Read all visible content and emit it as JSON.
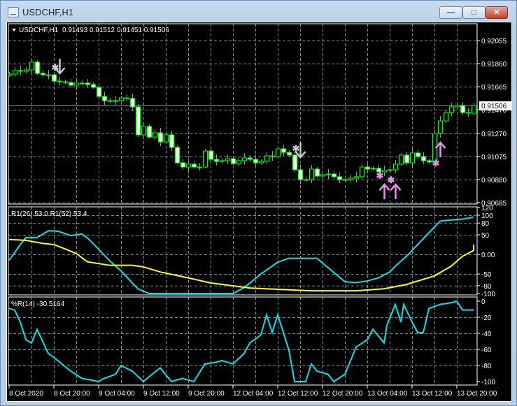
{
  "window": {
    "title": "USDCHF,H1",
    "buttons": {
      "minimize": "—",
      "maximize": "□",
      "close": "✕"
    }
  },
  "header": {
    "symbol": "USDCHF,H1",
    "ohlc": "0.91493 0.91512 0.91451 0.91506"
  },
  "colors": {
    "background": "#000000",
    "candle": "#00ff00",
    "bear_fill": "#ffffff",
    "grid": "#7f8a96",
    "line1": "#00e5ee",
    "line2": "#ffff00",
    "down_arrow": "#c8c8d2",
    "up_arrow": "#e88ef0"
  },
  "price_axis": {
    "labels": [
      "0.92055",
      "0.91860",
      "0.91665",
      "0.91470",
      "0.91270",
      "0.91075",
      "0.90880",
      "0.90685"
    ],
    "current_price": "0.91506"
  },
  "time_axis": {
    "labels": [
      "8 Oct 2020",
      "8 Oct 20:00",
      "9 Oct 04:00",
      "9 Oct 12:00",
      "9 Oct 20:00",
      "12 Oct 04:00",
      "12 Oct 12:00",
      "12 Oct 20:00",
      "13 Oct 04:00",
      "13 Oct 12:00",
      "13 Oct 20:00"
    ]
  },
  "chart_data": [
    {
      "type": "candlestick",
      "title": "USDCHF,H1",
      "ylim": [
        0.90685,
        0.92055
      ],
      "close": [
        0.91771,
        0.91801,
        0.91795,
        0.91807,
        0.91872,
        0.91777,
        0.91765,
        0.91765,
        0.91712,
        0.91706,
        0.917,
        0.91677,
        0.91695,
        0.91695,
        0.91683,
        0.91659,
        0.91582,
        0.91547,
        0.91541,
        0.91547,
        0.9157,
        0.91565,
        0.91494,
        0.91257,
        0.91328,
        0.91239,
        0.91275,
        0.91198,
        0.91257,
        0.91151,
        0.91021,
        0.90985,
        0.91009,
        0.90985,
        0.90985,
        0.91121,
        0.9105,
        0.91033,
        0.91039,
        0.91056,
        0.91015,
        0.91039,
        0.91062,
        0.9105,
        0.91021,
        0.91033,
        0.9108,
        0.91074,
        0.91139,
        0.91109,
        0.91086,
        0.90962,
        0.90879,
        0.90879,
        0.90968,
        0.90909,
        0.9092,
        0.90926,
        0.90903,
        0.90879,
        0.90879,
        0.90891,
        0.90903,
        0.90985,
        0.90968,
        0.90974,
        0.90944,
        0.90956,
        0.90962,
        0.91009,
        0.91086,
        0.91021,
        0.91104,
        0.91074,
        0.91039,
        0.91027,
        0.91269,
        0.91375,
        0.91446,
        0.91494,
        0.91505,
        0.91446,
        0.9144,
        0.91506
      ],
      "first_open": 0.9176,
      "markers": [
        {
          "kind": "star",
          "bar": 8,
          "price": 0.91825,
          "color": "#c8c8d2"
        },
        {
          "kind": "down-arrow",
          "bar": 9,
          "price": 0.9183,
          "color": "#c8c8d2"
        },
        {
          "kind": "star",
          "bar": 51,
          "price": 0.91139,
          "color": "#c8c8d2"
        },
        {
          "kind": "down-arrow",
          "bar": 52,
          "price": 0.91121,
          "color": "#c8c8d2"
        },
        {
          "kind": "star",
          "bar": 66,
          "price": 0.90908,
          "color": "#e88ef0"
        },
        {
          "kind": "up-arrow",
          "bar": 67,
          "price": 0.90784,
          "color": "#e88ef0"
        },
        {
          "kind": "star",
          "bar": 68,
          "price": 0.90873,
          "color": "#e88ef0"
        },
        {
          "kind": "up-arrow",
          "bar": 69,
          "price": 0.90784,
          "color": "#e88ef0"
        },
        {
          "kind": "star",
          "bar": 76,
          "price": 0.91015,
          "color": "#e88ef0"
        },
        {
          "kind": "up-arrow",
          "bar": 77,
          "price": 0.91139,
          "color": "#e88ef0"
        }
      ]
    },
    {
      "type": "line",
      "label": "R1(26) 53.0  R1(52) 53.4",
      "ylim": [
        -100,
        120
      ],
      "tick_labels": [
        "120",
        "100",
        "80",
        "50",
        "0.00",
        "-50",
        "-80",
        "-100"
      ],
      "ticks": [
        120,
        100,
        80,
        50,
        0,
        -50,
        -80,
        -100
      ],
      "grid_levels": [
        100,
        80,
        50,
        0,
        -50,
        -80
      ],
      "series": [
        {
          "name": "R1(26)",
          "color": "#00e5ee",
          "points": [
            [
              0,
              -15
            ],
            [
              2,
              25
            ],
            [
              3,
              43
            ],
            [
              5,
              43
            ],
            [
              7,
              60
            ],
            [
              8,
              60
            ],
            [
              9,
              58
            ],
            [
              11,
              48
            ],
            [
              12,
              50
            ],
            [
              13,
              52
            ],
            [
              14,
              42
            ],
            [
              16,
              13
            ],
            [
              18,
              -17
            ],
            [
              20,
              -42
            ],
            [
              23,
              -88
            ],
            [
              25,
              -100
            ],
            [
              40,
              -100
            ],
            [
              42,
              -85
            ],
            [
              45,
              -50
            ],
            [
              48,
              -20
            ],
            [
              50,
              -10
            ],
            [
              55,
              -10
            ],
            [
              60,
              -70
            ],
            [
              62,
              -72
            ],
            [
              64,
              -68
            ],
            [
              66,
              -60
            ],
            [
              68,
              -45
            ],
            [
              69,
              -30
            ],
            [
              71,
              -5
            ],
            [
              72,
              10
            ],
            [
              73,
              25
            ],
            [
              74,
              40
            ],
            [
              75,
              55
            ],
            [
              76,
              70
            ],
            [
              77,
              85
            ],
            [
              79,
              88
            ],
            [
              81,
              90
            ],
            [
              83,
              95
            ]
          ]
        },
        {
          "name": "R1(52)",
          "color": "#ffff00",
          "points": [
            [
              0,
              38
            ],
            [
              3,
              36
            ],
            [
              6,
              28
            ],
            [
              8,
              25
            ],
            [
              10,
              14
            ],
            [
              12,
              2
            ],
            [
              14,
              -19
            ],
            [
              18,
              -28
            ],
            [
              22,
              -28
            ],
            [
              24,
              -32
            ],
            [
              27,
              -45
            ],
            [
              32,
              -60
            ],
            [
              36,
              -73
            ],
            [
              43,
              -86
            ],
            [
              49,
              -90
            ],
            [
              54,
              -93
            ],
            [
              62,
              -93
            ],
            [
              67,
              -88
            ],
            [
              71,
              -77
            ],
            [
              76,
              -55
            ],
            [
              79,
              -30
            ],
            [
              81,
              -5
            ],
            [
              83,
              10
            ],
            [
              83,
              25
            ]
          ]
        }
      ]
    },
    {
      "type": "line",
      "label": "%R(14) -30.5164",
      "ylim": [
        -100,
        0
      ],
      "tick_labels": [
        "0",
        "-20",
        "-40",
        "-60",
        "-80",
        "-100"
      ],
      "ticks": [
        0,
        -20,
        -40,
        -60,
        -80,
        -100
      ],
      "series": [
        {
          "name": "%R(14)",
          "color": "#00e5ee",
          "points": [
            [
              0,
              -9
            ],
            [
              1,
              -11
            ],
            [
              2,
              -26
            ],
            [
              3,
              -48
            ],
            [
              4,
              -52
            ],
            [
              5,
              -35
            ],
            [
              7,
              -65
            ],
            [
              8,
              -70
            ],
            [
              11,
              -87
            ],
            [
              13,
              -96
            ],
            [
              16,
              -100
            ],
            [
              17,
              -96
            ],
            [
              19,
              -91
            ],
            [
              20,
              -80
            ],
            [
              22,
              -87
            ],
            [
              24,
              -100
            ],
            [
              25,
              -94
            ],
            [
              27,
              -83
            ],
            [
              29,
              -100
            ],
            [
              31,
              -96
            ],
            [
              33,
              -100
            ],
            [
              35,
              -78
            ],
            [
              37,
              -76
            ],
            [
              38,
              -74
            ],
            [
              40,
              -78
            ],
            [
              42,
              -65
            ],
            [
              43,
              -52
            ],
            [
              45,
              -42
            ],
            [
              46,
              -17
            ],
            [
              47,
              -39
            ],
            [
              48,
              -17
            ],
            [
              50,
              -61
            ],
            [
              51,
              -100
            ],
            [
              53,
              -100
            ],
            [
              54,
              -78
            ],
            [
              55,
              -87
            ],
            [
              57,
              -91
            ],
            [
              58,
              -100
            ],
            [
              60,
              -91
            ],
            [
              62,
              -57
            ],
            [
              64,
              -48
            ],
            [
              65,
              -35
            ],
            [
              67,
              -52
            ],
            [
              67.5,
              -30
            ],
            [
              69,
              -4
            ],
            [
              70,
              -26
            ],
            [
              70.5,
              -4
            ],
            [
              72,
              -26
            ],
            [
              73,
              -39
            ],
            [
              74,
              -39
            ],
            [
              75,
              -9
            ],
            [
              77,
              -4
            ],
            [
              79,
              -2
            ],
            [
              80,
              0
            ],
            [
              81,
              -11
            ],
            [
              83,
              -11
            ]
          ]
        }
      ]
    }
  ]
}
